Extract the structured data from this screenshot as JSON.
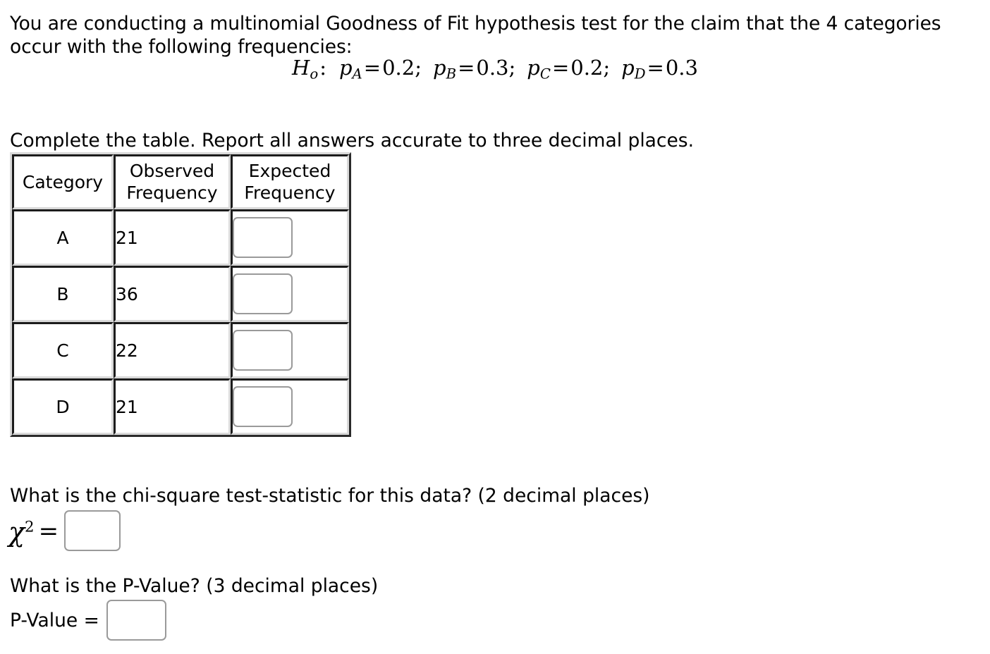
{
  "prompt": {
    "text": "You are conducting a multinomial Goodness of Fit hypothesis test for the claim that the 4 categories occur with the following frequencies:"
  },
  "hypothesis": {
    "symbol": "H",
    "symbol_sub": "o",
    "colon": ":",
    "terms": [
      {
        "var": "p",
        "sub": "A",
        "eq": "=",
        "value": "0.2",
        "sep": ";"
      },
      {
        "var": "p",
        "sub": "B",
        "eq": "=",
        "value": "0.3",
        "sep": ";"
      },
      {
        "var": "p",
        "sub": "C",
        "eq": "=",
        "value": "0.2",
        "sep": ";"
      },
      {
        "var": "p",
        "sub": "D",
        "eq": "=",
        "value": "0.3",
        "sep": ""
      }
    ]
  },
  "instruction": {
    "text": "Complete the table. Report all answers accurate to three decimal places."
  },
  "table": {
    "headers": [
      "Category",
      "Observed Frequency",
      "Expected Frequency"
    ],
    "header_lines": [
      [
        "Category"
      ],
      [
        "Observed",
        "Frequency"
      ],
      [
        "Expected",
        "Frequency"
      ]
    ],
    "rows": [
      {
        "category": "A",
        "observed": "21",
        "expected": "",
        "expected_placeholder": ""
      },
      {
        "category": "B",
        "observed": "36",
        "expected": "",
        "expected_placeholder": ""
      },
      {
        "category": "C",
        "observed": "22",
        "expected": "",
        "expected_placeholder": ""
      },
      {
        "category": "D",
        "observed": "21",
        "expected": "",
        "expected_placeholder": ""
      }
    ]
  },
  "chi_square": {
    "question": "What is the chi-square test-statistic for this data? (2 decimal places)",
    "symbol": "χ",
    "exponent": "2",
    "equals": "=",
    "value": "",
    "placeholder": ""
  },
  "p_value": {
    "question": "What is the P-Value? (3 decimal places)",
    "label": "P-Value =",
    "value": "",
    "placeholder": ""
  },
  "colors": {
    "text": "#000000",
    "background": "#ffffff",
    "input_border": "#9a9a9a",
    "cell_border_dark": "#1c1c1c",
    "cell_border_light": "#d9d9d9"
  }
}
